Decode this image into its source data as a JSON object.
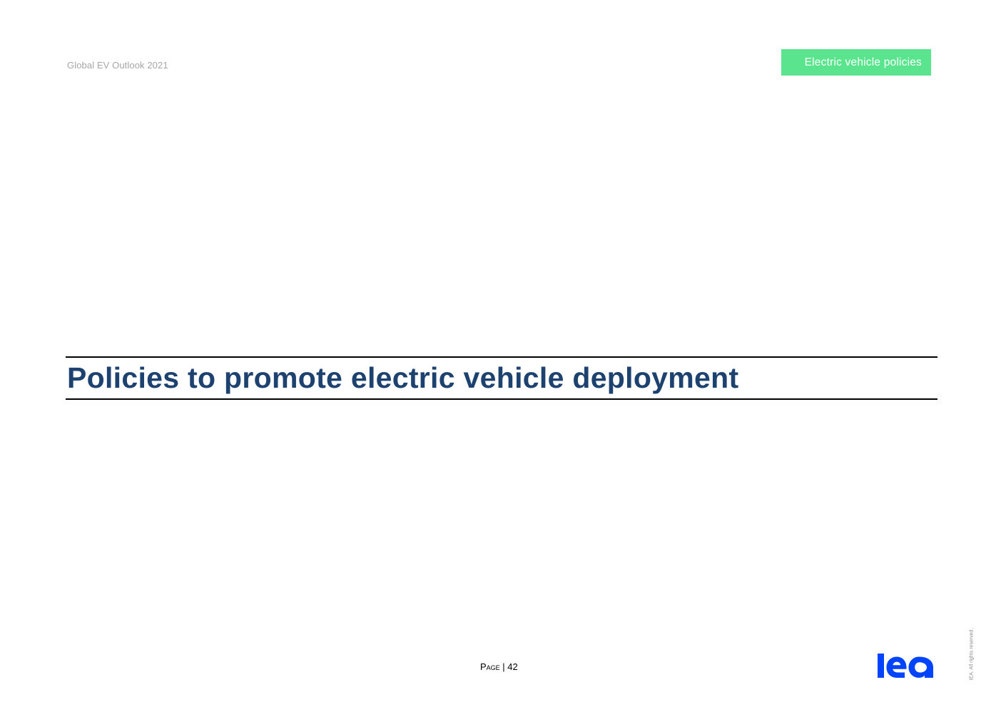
{
  "header": {
    "document_title": "Global EV Outlook 2021",
    "section_tag": "Electric vehicle policies",
    "section_tag_color": "#5ae48e"
  },
  "main": {
    "chapter_title": "Policies to promote electric vehicle deployment",
    "chapter_title_color": "#1d426f"
  },
  "footer": {
    "page_label": "Page",
    "page_separator": " | ",
    "page_number": "42",
    "logo": "iea",
    "logo_color": "#0044ff",
    "rights_note": "IEA. All rights reserved."
  }
}
